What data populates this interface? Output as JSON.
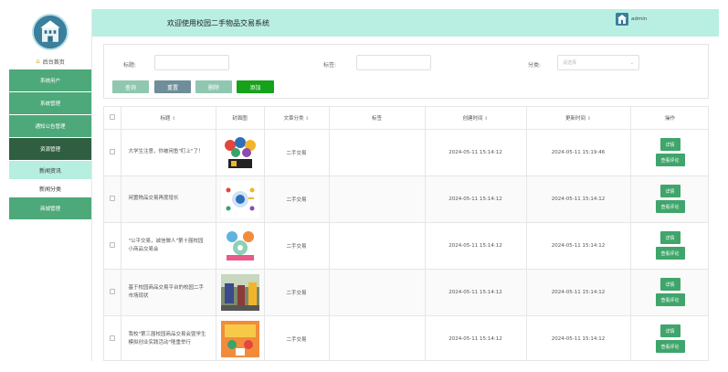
{
  "header": {
    "title": "欢迎使用校园二手物品交易系统",
    "username": "admin"
  },
  "sidebar": {
    "home_label": "后台首页",
    "items": [
      {
        "label": "系统用户"
      },
      {
        "label": "系统管理"
      },
      {
        "label": "通知公告管理"
      },
      {
        "label": "资源管理"
      },
      {
        "label": "新闻资讯"
      },
      {
        "label": "新闻分类"
      },
      {
        "label": "商城管理"
      }
    ]
  },
  "search": {
    "title_label": "标题:",
    "tags_label": "标签:",
    "category_label": "分类:",
    "category_placeholder": "请选择",
    "btn_query": "查询",
    "btn_reset": "重置",
    "btn_delete": "删除",
    "btn_add": "添加"
  },
  "table": {
    "headers": [
      "标题",
      "封面图",
      "文章分类",
      "标签",
      "创建时间",
      "更新时间",
      "操作"
    ],
    "sort_mark": "⇕",
    "detail_label": "详情",
    "review_label": "查看评论",
    "rows": [
      {
        "title": "大学生注意，你被闲鱼\"盯上\"了！",
        "category": "二手交易",
        "tags": "",
        "created": "2024-05-11 15:14:12",
        "updated": "2024-05-11 15:19:46"
      },
      {
        "title": "闲置物品交易再度增长",
        "category": "二手交易",
        "tags": "",
        "created": "2024-05-11 15:14:12",
        "updated": "2024-05-11 15:14:12"
      },
      {
        "title": "\"公平交易，诚信做人\"第十届校园小商品交易会",
        "category": "二手交易",
        "tags": "",
        "created": "2024-05-11 15:14:12",
        "updated": "2024-05-11 15:14:12"
      },
      {
        "title": "基于校园商品交易平台的校园二手市场现状",
        "category": "二手交易",
        "tags": "",
        "created": "2024-05-11 15:14:12",
        "updated": "2024-05-11 15:14:12"
      },
      {
        "title": "我校\"第三届校园商品交易会暨学生模拟创业实践活动\"隆重举行",
        "category": "二手交易",
        "tags": "",
        "created": "2024-05-11 15:14:12",
        "updated": "2024-05-11 15:14:12"
      }
    ]
  }
}
